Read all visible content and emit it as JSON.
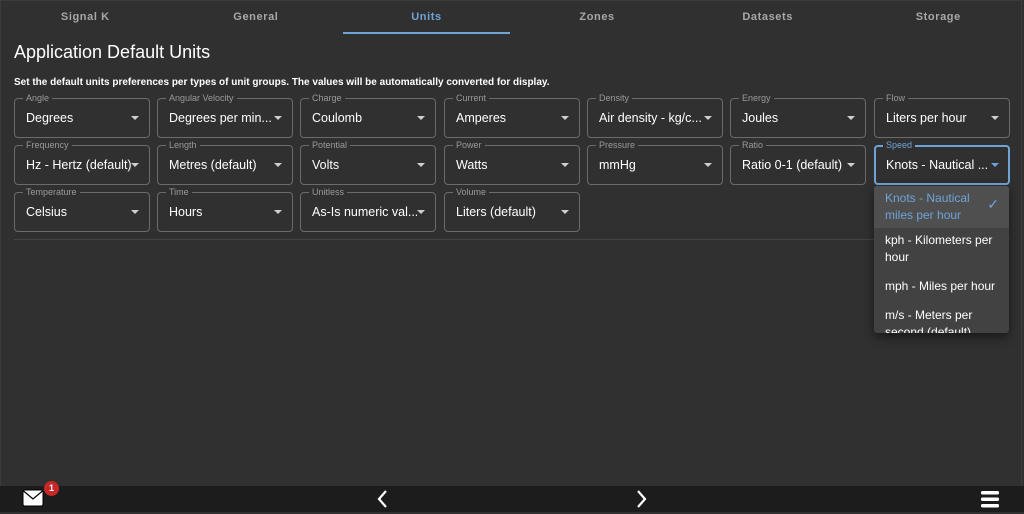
{
  "tabs": [
    {
      "label": "Signal K",
      "active": false
    },
    {
      "label": "General",
      "active": false
    },
    {
      "label": "Units",
      "active": true
    },
    {
      "label": "Zones",
      "active": false
    },
    {
      "label": "Datasets",
      "active": false
    },
    {
      "label": "Storage",
      "active": false
    }
  ],
  "page": {
    "title": "Application Default Units",
    "description": "Set the default units preferences per types of unit groups. The values will be automatically converted for display."
  },
  "units": [
    {
      "label": "Angle",
      "value": "Degrees"
    },
    {
      "label": "Angular Velocity",
      "value": "Degrees per min..."
    },
    {
      "label": "Charge",
      "value": "Coulomb"
    },
    {
      "label": "Current",
      "value": "Amperes"
    },
    {
      "label": "Density",
      "value": "Air density - kg/c..."
    },
    {
      "label": "Energy",
      "value": "Joules"
    },
    {
      "label": "Flow",
      "value": "Liters per hour"
    },
    {
      "label": "Frequency",
      "value": "Hz - Hertz (default)"
    },
    {
      "label": "Length",
      "value": "Metres (default)"
    },
    {
      "label": "Potential",
      "value": "Volts"
    },
    {
      "label": "Power",
      "value": "Watts"
    },
    {
      "label": "Pressure",
      "value": "mmHg"
    },
    {
      "label": "Ratio",
      "value": "Ratio 0-1 (default)"
    },
    {
      "label": "Speed",
      "value": "Knots - Nautical ...",
      "focused": true
    },
    {
      "label": "Temperature",
      "value": "Celsius"
    },
    {
      "label": "Time",
      "value": "Hours"
    },
    {
      "label": "Unitless",
      "value": "As-Is numeric val..."
    },
    {
      "label": "Volume",
      "value": "Liters (default)"
    }
  ],
  "speed_dropdown": {
    "options": [
      {
        "label": "Knots - Nautical miles per hour",
        "selected": true
      },
      {
        "label": "kph - Kilometers per hour",
        "selected": false
      },
      {
        "label": "mph - Miles per hour",
        "selected": false
      },
      {
        "label": "m/s - Meters per second (default)",
        "selected": false
      }
    ],
    "check_icon": "✓"
  },
  "bottom_bar": {
    "notifications_count": "1",
    "icons": [
      "mail-icon",
      "chevron-left-icon",
      "chevron-right-icon",
      "menu-icon"
    ]
  },
  "colors": {
    "accent": "#6fa3d8",
    "background": "#303030",
    "badge": "#c62828"
  }
}
